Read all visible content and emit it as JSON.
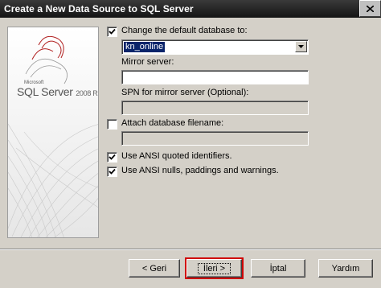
{
  "window": {
    "title": "Create a New Data Source to SQL Server"
  },
  "banner": {
    "logo_brand": "Microsoft",
    "logo_product": "SQL Server",
    "logo_version": "2008 R2"
  },
  "options": {
    "change_default_db": {
      "label": "Change the default database to:",
      "checked": true,
      "value": "kn_online"
    },
    "mirror_server": {
      "label": "Mirror server:",
      "value": ""
    },
    "spn_mirror": {
      "label": "SPN for mirror server (Optional):",
      "value": ""
    },
    "attach_db": {
      "label": "Attach database filename:",
      "checked": false,
      "value": ""
    },
    "ansi_quoted": {
      "label": "Use ANSI quoted identifiers.",
      "checked": true
    },
    "ansi_nulls": {
      "label": "Use ANSI nulls, paddings and warnings.",
      "checked": true
    }
  },
  "buttons": {
    "back": "< Geri",
    "next": "İleri >",
    "cancel": "İptal",
    "help": "Yardım"
  }
}
